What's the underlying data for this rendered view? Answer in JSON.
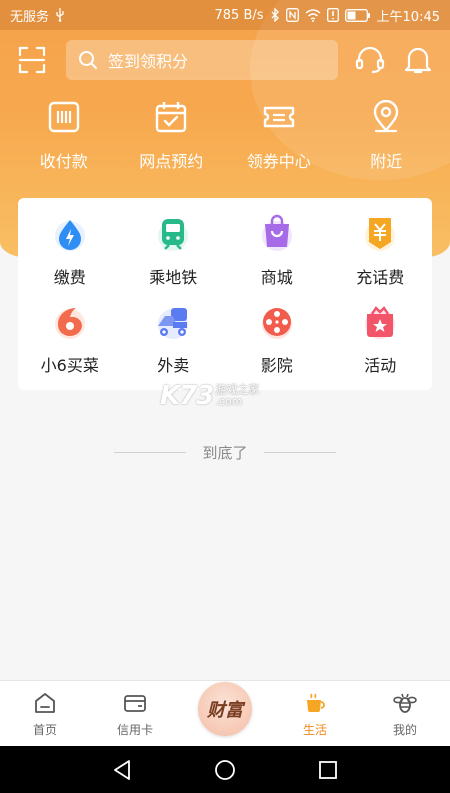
{
  "status_bar": {
    "carrier": "无服务",
    "speed": "785 B/s",
    "time": "上午10:45"
  },
  "search": {
    "placeholder": "签到领积分"
  },
  "quick_actions": [
    {
      "label": "收付款",
      "icon": "pay-icon"
    },
    {
      "label": "网点预约",
      "icon": "calendar-icon"
    },
    {
      "label": "领券中心",
      "icon": "coupon-icon"
    },
    {
      "label": "附近",
      "icon": "location-icon"
    }
  ],
  "services": [
    {
      "label": "缴费",
      "icon": "bill-icon",
      "color": "#2f8ef4"
    },
    {
      "label": "乘地铁",
      "icon": "metro-icon",
      "color": "#27b98a"
    },
    {
      "label": "商城",
      "icon": "mall-icon",
      "color": "#a86be8"
    },
    {
      "label": "充话费",
      "icon": "phone-recharge-icon",
      "color": "#f5a623"
    },
    {
      "label": "小6买菜",
      "icon": "grocery-icon",
      "color": "#f26b4d"
    },
    {
      "label": "外卖",
      "icon": "delivery-icon",
      "color": "#5b7cf0"
    },
    {
      "label": "影院",
      "icon": "cinema-icon",
      "color": "#f25c4d"
    },
    {
      "label": "活动",
      "icon": "activity-icon",
      "color": "#f2546a"
    }
  ],
  "watermark": {
    "brand": "K73",
    "site": "游戏之家",
    "domain": ".com"
  },
  "end_text": "到底了",
  "bottom_nav": [
    {
      "label": "首页",
      "icon": "home-icon"
    },
    {
      "label": "信用卡",
      "icon": "card-icon"
    },
    {
      "label": "财富",
      "icon": "fortune-icon"
    },
    {
      "label": "生活",
      "icon": "coffee-icon",
      "active": true
    },
    {
      "label": "我的",
      "icon": "bee-icon"
    }
  ],
  "colors": {
    "accent": "#f08a1c",
    "header_top": "#f6a24a",
    "header_bottom": "#f9bf63"
  }
}
